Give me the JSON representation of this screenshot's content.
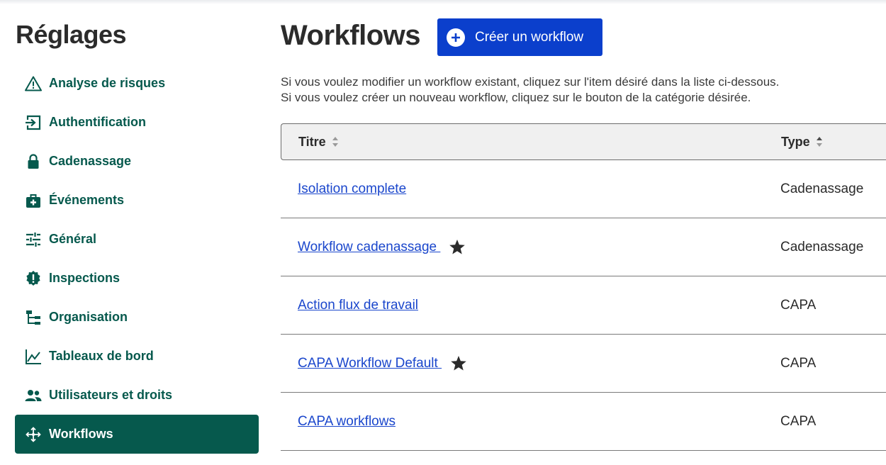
{
  "sidebar": {
    "title": "Réglages",
    "items": [
      {
        "label": "Analyse de risques",
        "icon": "warning-icon",
        "active": false
      },
      {
        "label": "Authentification",
        "icon": "login-icon",
        "active": false
      },
      {
        "label": "Cadenassage",
        "icon": "lock-icon",
        "active": false
      },
      {
        "label": "Événements",
        "icon": "medical-bag-icon",
        "active": false
      },
      {
        "label": "Général",
        "icon": "sliders-icon",
        "active": false
      },
      {
        "label": "Inspections",
        "icon": "alert-badge-icon",
        "active": false
      },
      {
        "label": "Organisation",
        "icon": "hierarchy-icon",
        "active": false
      },
      {
        "label": "Tableaux de bord",
        "icon": "line-chart-icon",
        "active": false
      },
      {
        "label": "Utilisateurs et droits",
        "icon": "users-icon",
        "active": false
      },
      {
        "label": "Workflows",
        "icon": "move-arrows-icon",
        "active": true
      }
    ]
  },
  "main": {
    "title": "Workflows",
    "create_button": "Créer un workflow",
    "description": [
      "Si vous voulez modifier un workflow existant, cliquez sur l'item désiré dans la liste ci-dessous.",
      "Si vous voulez créer un nouveau workflow, cliquez sur le bouton de la catégorie désirée."
    ],
    "table": {
      "columns": [
        "Titre",
        "Type"
      ],
      "rows": [
        {
          "title": "Isolation complete",
          "type": "Cadenassage",
          "starred": false
        },
        {
          "title": "Workflow cadenassage ",
          "type": "Cadenassage",
          "starred": true
        },
        {
          "title": "Action flux de travail",
          "type": "CAPA",
          "starred": false
        },
        {
          "title": "CAPA Workflow Default ",
          "type": "CAPA",
          "starred": true
        },
        {
          "title": "CAPA workflows",
          "type": "CAPA",
          "starred": false
        }
      ]
    }
  },
  "colors": {
    "brand_green": "#06594d",
    "primary_blue": "#0b3fcc",
    "link_blue": "#1a46cc"
  }
}
